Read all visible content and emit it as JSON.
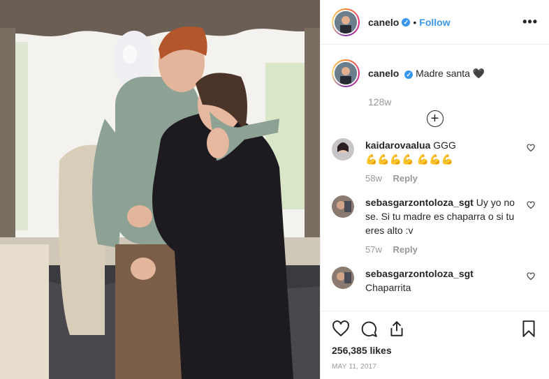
{
  "post": {
    "username": "canelo",
    "follow_label": "Follow",
    "dot": "•",
    "more_icon": "more-options-icon",
    "more_label": "•••"
  },
  "caption": {
    "username": "canelo",
    "text": "Madre santa",
    "heart_emoji": "🖤",
    "time": "128w"
  },
  "load_more_icon": "plus-circle-icon",
  "load_more_symbol": "+",
  "comments": [
    {
      "username": "kaidarovaalua",
      "text": "GGG",
      "emojis": "💪💪💪💪 💪💪💪",
      "time": "58w",
      "reply": "Reply"
    },
    {
      "username": "sebasgarzontoloza_sgt",
      "text": "Uy yo no se. Si tu madre es chaparra o si tu eres alto :v",
      "time": "57w",
      "reply": "Reply"
    },
    {
      "username": "sebasgarzontoloza_sgt",
      "text": "Chaparrita"
    }
  ],
  "actions": {
    "like_icon": "heart-icon",
    "comment_icon": "comment-icon",
    "share_icon": "share-icon",
    "save_icon": "bookmark-icon",
    "likes": "256,385 likes",
    "date": "MAY 11, 2017"
  },
  "colors": {
    "link": "#3897f0",
    "muted": "#999999",
    "text": "#262626",
    "border": "#efefef"
  }
}
